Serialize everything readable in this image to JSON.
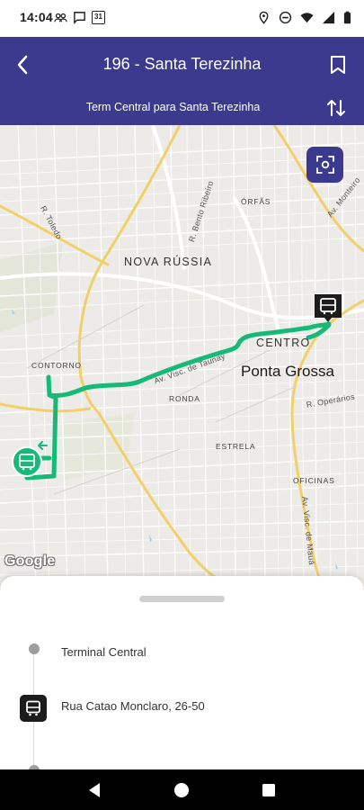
{
  "status_bar": {
    "time": "14:04",
    "left_icons": [
      "people-icon",
      "chat-icon",
      "calendar-icon"
    ],
    "calendar_day": "31",
    "right_icons": [
      "location-icon",
      "do-not-disturb-icon",
      "wifi-icon",
      "signal-icon",
      "battery-icon"
    ]
  },
  "header": {
    "title": "196 - Santa Terezinha",
    "subtitle": "Term Central para Santa Terezinha",
    "background": "#3b3a8e"
  },
  "map": {
    "district_labels": {
      "nova_russia": "NOVA RÚSSIA",
      "centro": "CENTRO",
      "contorno": "CONTORNO",
      "ronda": "RONDA",
      "estrela": "ESTRELA",
      "orfas": "ÓRFÃS",
      "oficinas": "OFICINAS"
    },
    "city_label": "Ponta Grossa",
    "street_labels": {
      "toledo": "R. Toledo",
      "bento_ribeiro": "R. Bento Ribeiro",
      "monteiro": "Av. Monteiro",
      "visc_taunay": "Av. Visc. de Taunay",
      "operarios": "R. Operários",
      "visc_maua": "Av. Visc. de Mauá"
    },
    "attribution": "Google",
    "route_color": "#17b978",
    "road_color": "#f3cf6a"
  },
  "stops": [
    {
      "label": "Terminal Central",
      "type": "dot"
    },
    {
      "label": "Rua Catao Monclaro, 26-50",
      "type": "bus"
    }
  ]
}
